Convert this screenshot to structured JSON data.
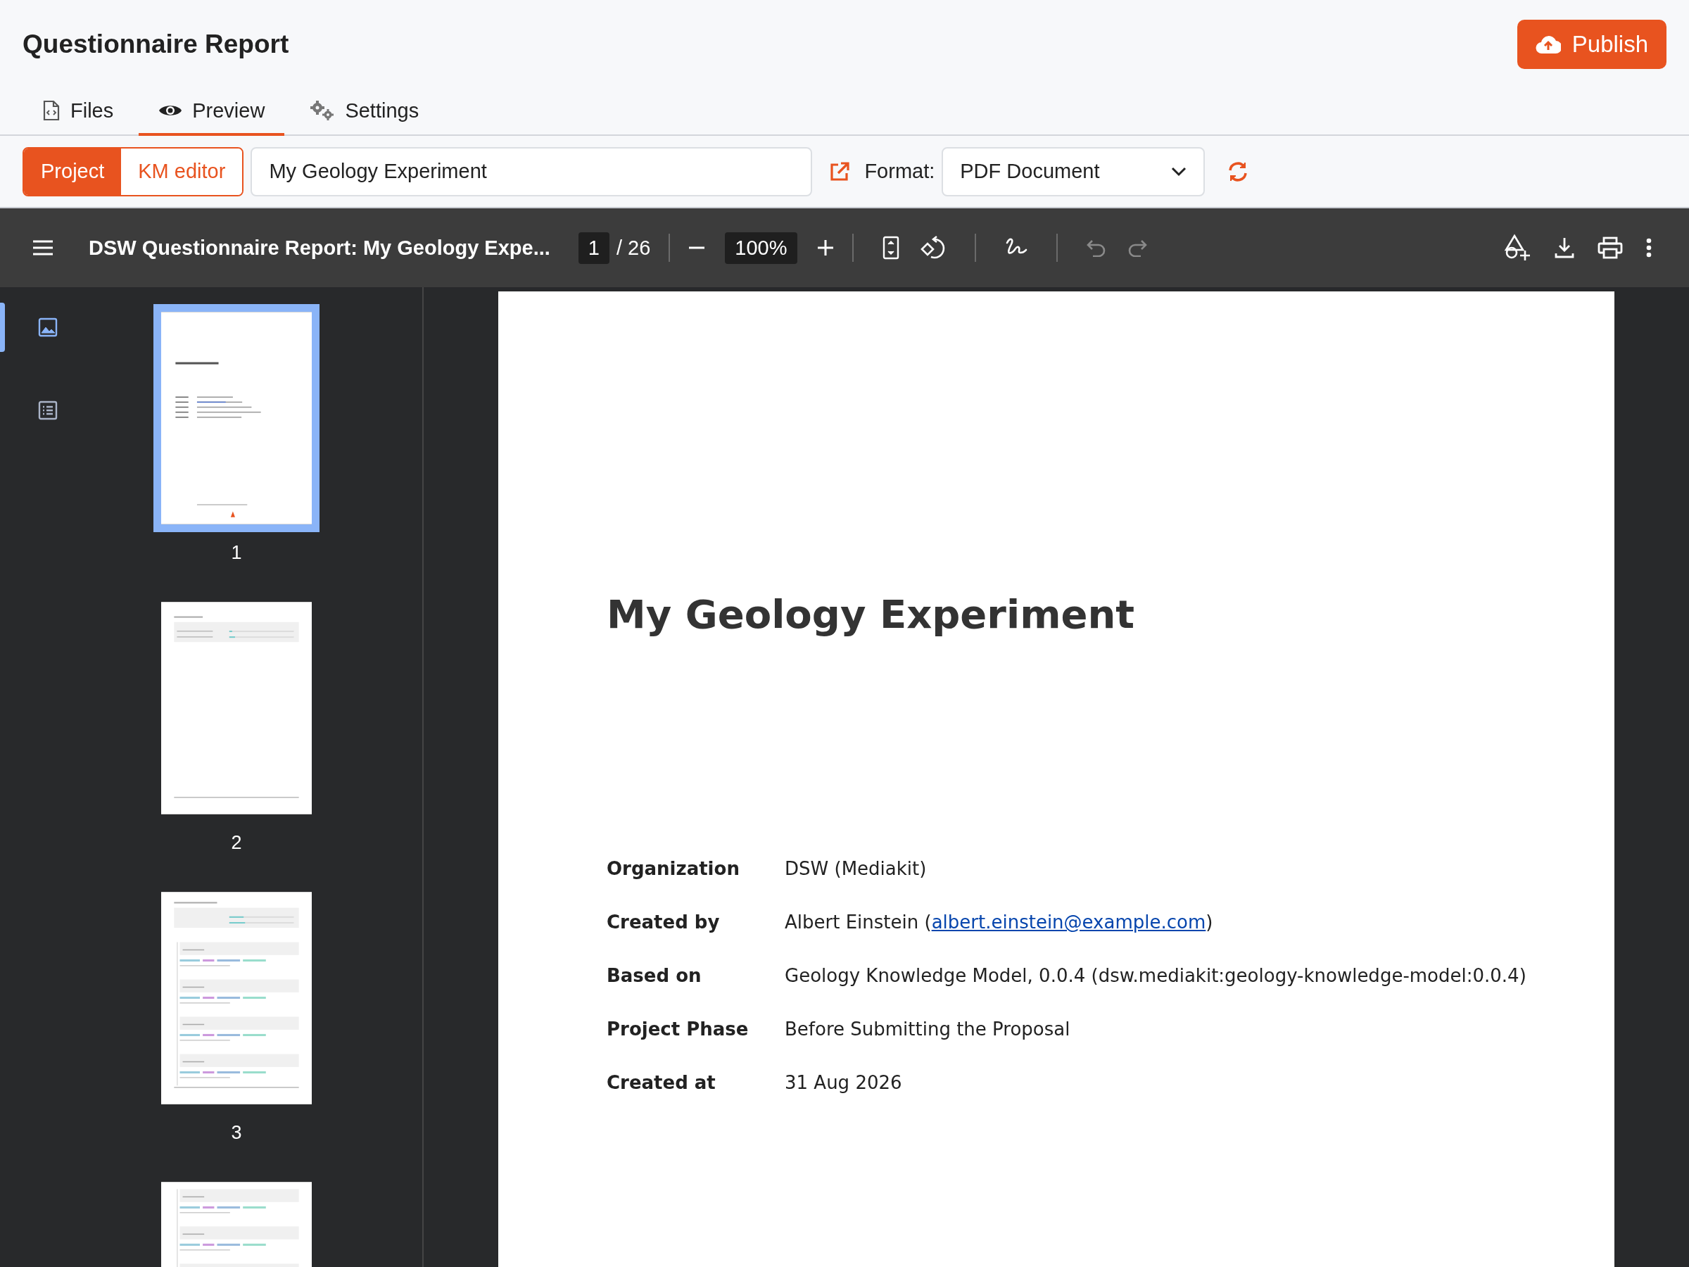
{
  "header": {
    "title": "Questionnaire Report",
    "publish_button": "Publish"
  },
  "tabs": [
    {
      "label": "Files",
      "kind": "files",
      "selected": false
    },
    {
      "label": "Preview",
      "kind": "preview",
      "selected": true
    },
    {
      "label": "Settings",
      "kind": "settings",
      "selected": false
    }
  ],
  "source_toggle": [
    {
      "label": "Project",
      "selected": true
    },
    {
      "label": "KM editor",
      "selected": false
    }
  ],
  "project_field": {
    "value": "My Geology Experiment"
  },
  "format": {
    "label": "Format:",
    "value": "PDF Document"
  },
  "viewer": {
    "title": "DSW Questionnaire Report: My Geology Expe...",
    "page": "1",
    "page_count": "/ 26",
    "zoom": "100%",
    "tools": [
      {
        "kind": "fit-page",
        "disabled": false
      },
      {
        "kind": "rotate",
        "disabled": false
      },
      {
        "kind": "draw",
        "disabled": false
      },
      {
        "kind": "undo",
        "disabled": true
      },
      {
        "kind": "redo",
        "disabled": true
      }
    ],
    "actions": [
      {
        "kind": "annotate"
      },
      {
        "kind": "download"
      },
      {
        "kind": "print"
      },
      {
        "kind": "more"
      }
    ],
    "sidebar_tabs": [
      {
        "kind": "thumbnails",
        "selected": true
      },
      {
        "kind": "outline",
        "selected": false
      }
    ],
    "thumbnails": [
      {
        "label": "1",
        "kind": "cover",
        "selected": true
      },
      {
        "label": "2",
        "kind": "summary",
        "selected": false
      },
      {
        "label": "3",
        "kind": "section",
        "selected": false
      },
      {
        "kind": "answers",
        "selected": false
      }
    ],
    "document": {
      "title": "My Geology Experiment",
      "fields": [
        {
          "label": "Organization",
          "value": "DSW (Mediakit)"
        },
        {
          "label": "Created by",
          "value": "Albert Einstein (",
          "link": "albert.einstein@example.com",
          "suffix": ")"
        },
        {
          "label": "Based on",
          "value": "Geology Knowledge Model, 0.0.4 (dsw.mediakit:geology-knowledge-model:0.0.4)"
        },
        {
          "label": "Project Phase",
          "value": "Before Submitting the Proposal"
        },
        {
          "label": "Created at",
          "value": "31 Aug 2026"
        }
      ]
    }
  }
}
